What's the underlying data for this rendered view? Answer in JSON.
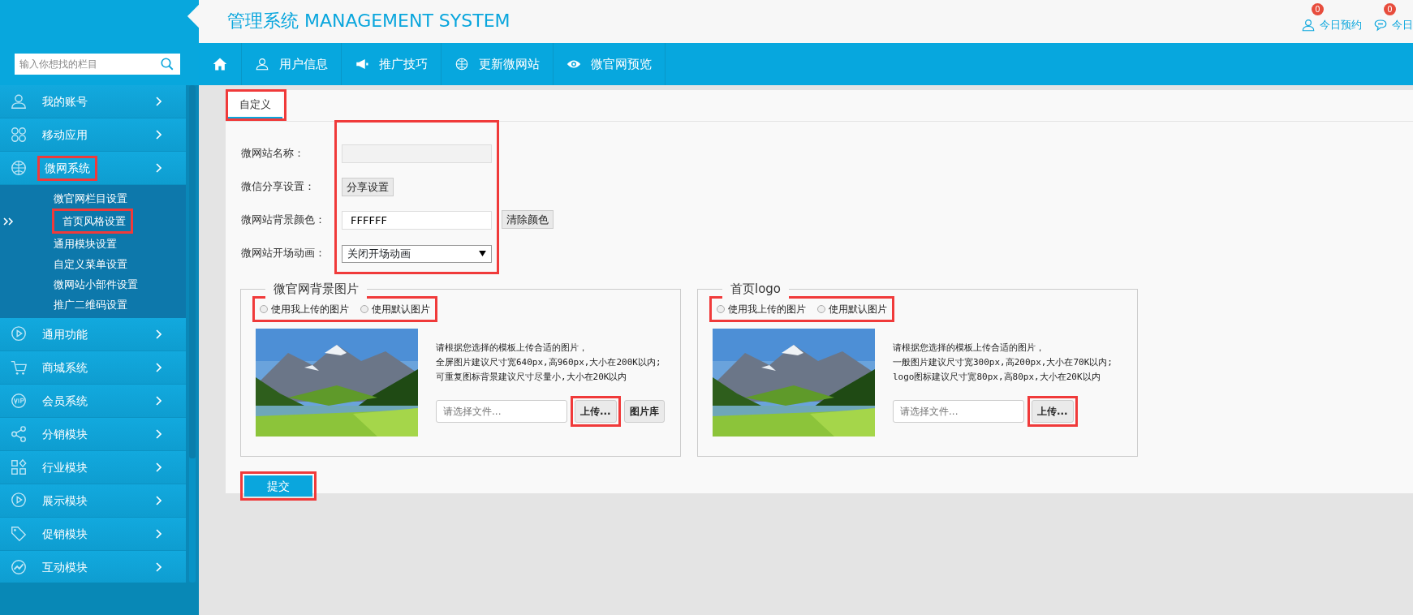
{
  "header": {
    "title": "管理系统 MANAGEMENT SYSTEM",
    "shortcuts": [
      {
        "kind": "person",
        "label": "今日预约",
        "badge": "0"
      },
      {
        "kind": "chat",
        "label": "今日",
        "badge": "0"
      }
    ]
  },
  "search": {
    "placeholder": "输入你想找的栏目"
  },
  "topnav": [
    {
      "kind": "home"
    },
    {
      "kind": "user",
      "label": "用户信息"
    },
    {
      "kind": "megaphone",
      "label": "推广技巧"
    },
    {
      "kind": "globe",
      "label": "更新微网站"
    },
    {
      "kind": "eye",
      "label": "微官网预览"
    }
  ],
  "sidebar": {
    "items": [
      {
        "kind": "user",
        "label": "我的账号",
        "expanded": false,
        "highlighted": false
      },
      {
        "kind": "apps",
        "label": "移动应用",
        "expanded": false,
        "highlighted": false
      },
      {
        "kind": "globe",
        "label": "微网系统",
        "expanded": true,
        "highlighted": true,
        "children": [
          {
            "label": "微官网栏目设置",
            "selected": false,
            "highlighted": false
          },
          {
            "label": "首页风格设置",
            "selected": true,
            "highlighted": true
          },
          {
            "label": "通用模块设置",
            "selected": false,
            "highlighted": false
          },
          {
            "label": "自定义菜单设置",
            "selected": false,
            "highlighted": false
          },
          {
            "label": "微网站小部件设置",
            "selected": false,
            "highlighted": false
          },
          {
            "label": "推广二维码设置",
            "selected": false,
            "highlighted": false
          }
        ]
      },
      {
        "kind": "play",
        "label": "通用功能",
        "expanded": false,
        "highlighted": false
      },
      {
        "kind": "cart",
        "label": "商城系统",
        "expanded": false,
        "highlighted": false
      },
      {
        "kind": "vip",
        "label": "会员系统",
        "expanded": false,
        "highlighted": false
      },
      {
        "kind": "share",
        "label": "分销模块",
        "expanded": false,
        "highlighted": false
      },
      {
        "kind": "grid",
        "label": "行业模块",
        "expanded": false,
        "highlighted": false
      },
      {
        "kind": "play",
        "label": "展示模块",
        "expanded": false,
        "highlighted": false
      },
      {
        "kind": "tag",
        "label": "促销模块",
        "expanded": false,
        "highlighted": false
      },
      {
        "kind": "chart",
        "label": "互动模块",
        "expanded": false,
        "highlighted": false
      }
    ]
  },
  "tabs": [
    {
      "label": "自定义",
      "selected": true,
      "highlighted": true
    }
  ],
  "form": {
    "highlighted": true,
    "fields": [
      {
        "kind": "input",
        "label": "微网站名称：",
        "disabled": true
      },
      {
        "kind": "button",
        "label": "微信分享设置：",
        "button": "分享设置"
      },
      {
        "kind": "input",
        "label": "微网站背景颜色：",
        "value": "FFFFFF",
        "disabled": false,
        "button": "清除颜色"
      },
      {
        "kind": "select",
        "label": "微网站开场动画：",
        "value": "关闭开场动画"
      }
    ]
  },
  "panels": [
    {
      "legend": "微官网背景图片",
      "options_highlighted": true,
      "options": [
        {
          "label": "使用我上传的图片",
          "selected": false
        },
        {
          "label": "使用默认图片",
          "selected": false
        }
      ],
      "notes": [
        "请根据您选择的模板上传合适的图片，",
        "全屏图片建议尺寸宽640px,高960px,大小在200K以内;",
        "可重复图标背景建议尺寸尽量小,大小在20K以内"
      ],
      "file_placeholder": "请选择文件...",
      "buttons": [
        {
          "label": "上传...",
          "highlighted": true
        },
        {
          "label": "图片库",
          "highlighted": false
        }
      ]
    },
    {
      "legend": "首页logo",
      "options_highlighted": true,
      "options": [
        {
          "label": "使用我上传的图片",
          "selected": false
        },
        {
          "label": "使用默认图片",
          "selected": false
        }
      ],
      "notes": [
        "请根据您选择的模板上传合适的图片，",
        "一般图片建议尺寸宽300px,高200px,大小在70K以内;",
        "logo图标建议尺寸宽80px,高80px,大小在20K以内"
      ],
      "file_placeholder": "请选择文件...",
      "buttons": [
        {
          "label": "上传...",
          "highlighted": true
        }
      ]
    }
  ],
  "submit": {
    "label": "提交",
    "highlighted": true
  }
}
